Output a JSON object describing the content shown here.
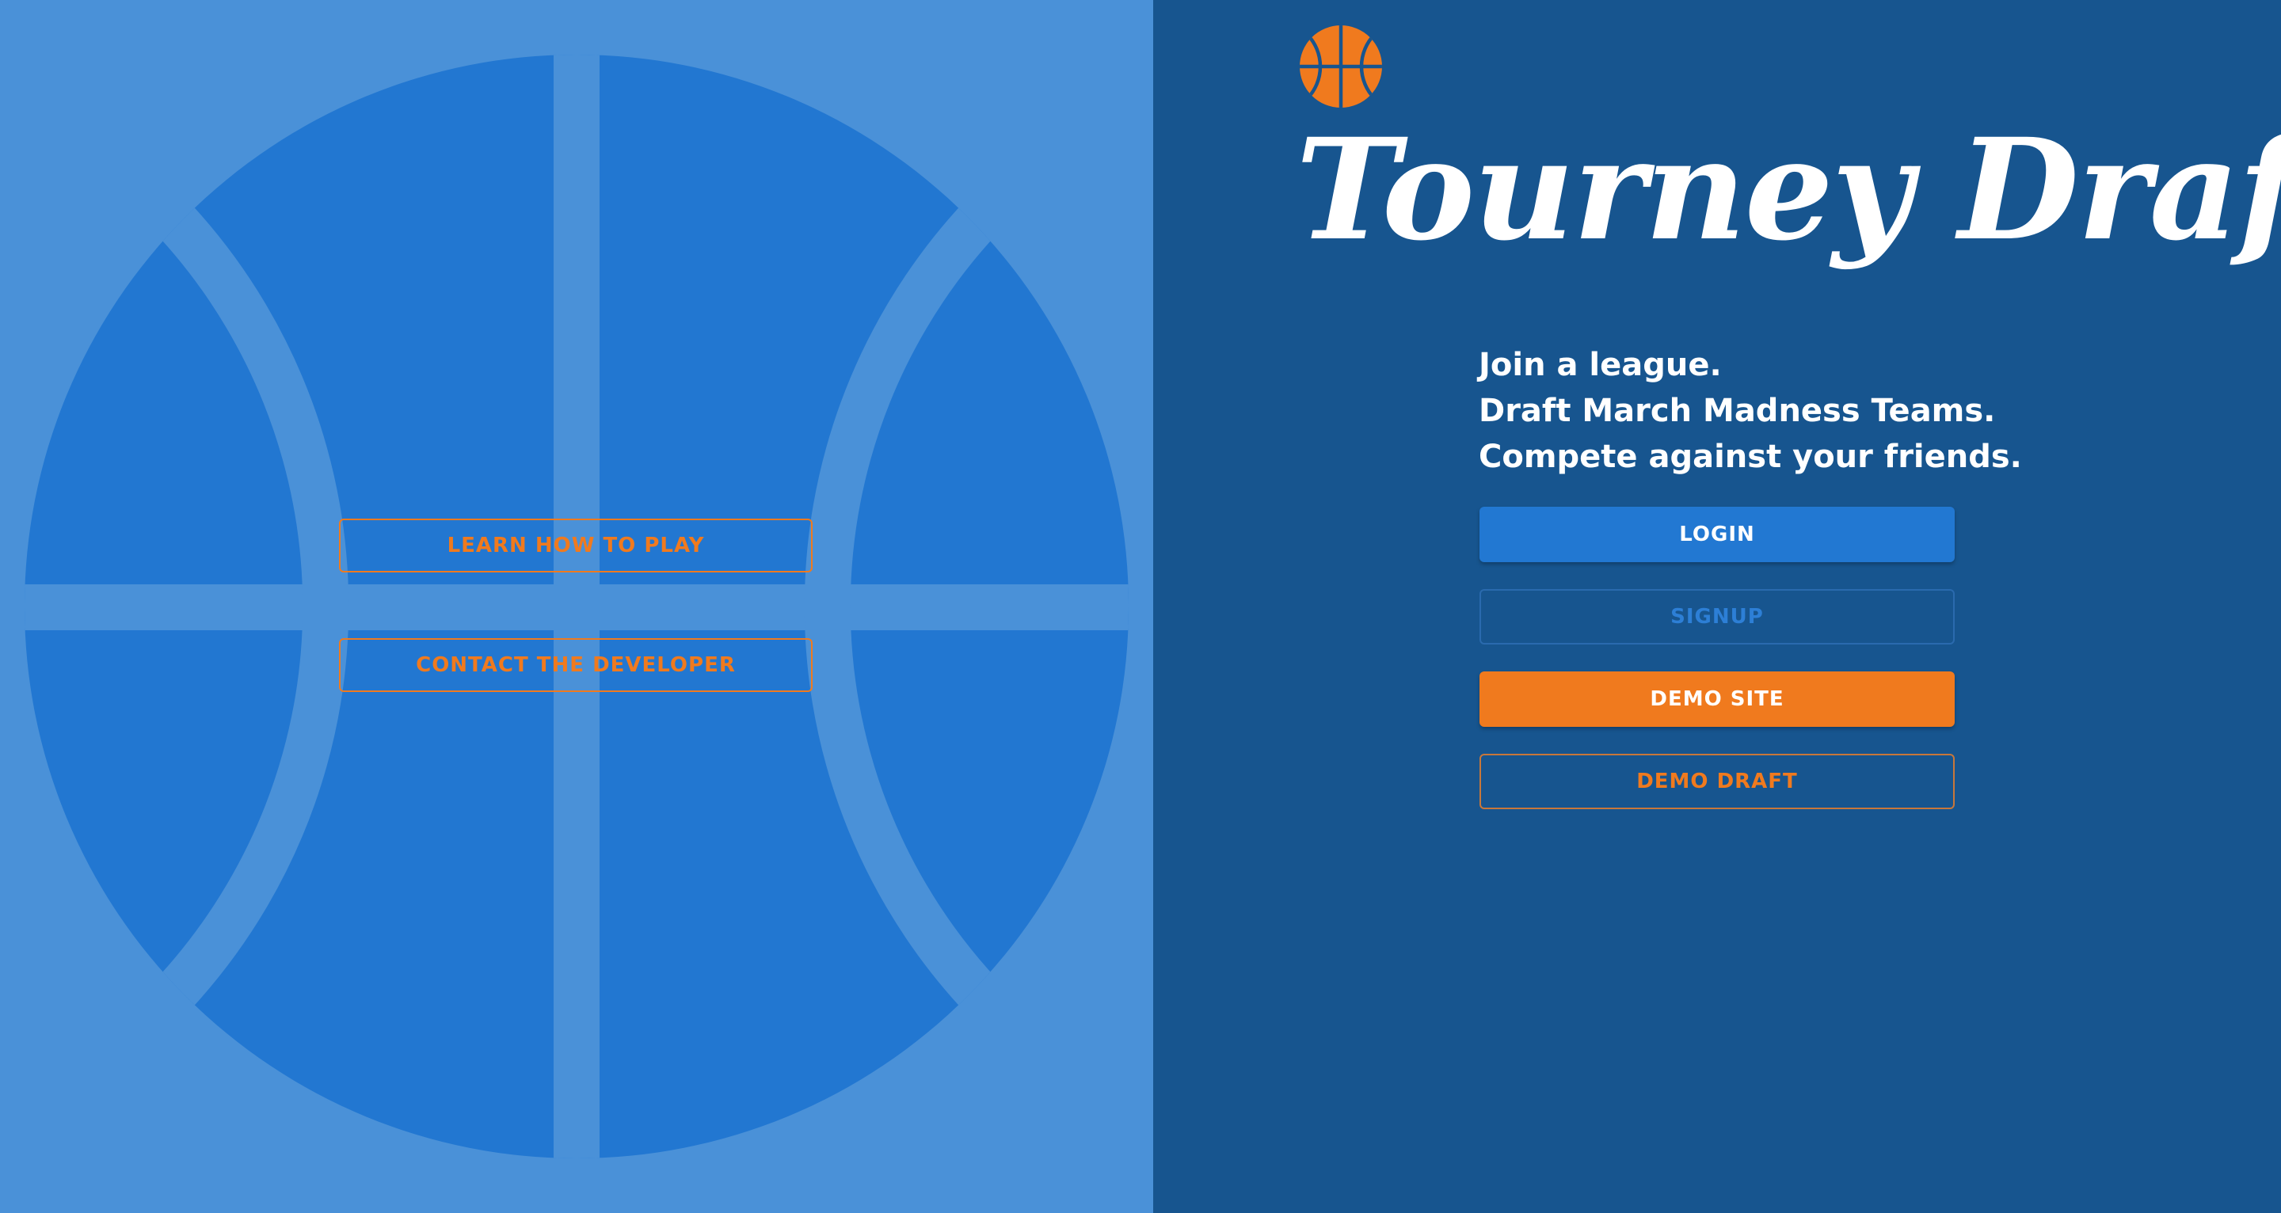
{
  "colors": {
    "left_background": "#4a91d8",
    "ball_fill": "#2277d1",
    "right_background": "#17558f",
    "accent_orange": "#f07a1e",
    "primary_blue": "#2278d2",
    "text_white": "#ffffff"
  },
  "left": {
    "background_graphic": "basketball-icon",
    "learn_button": "LEARN HOW TO PLAY",
    "contact_button": "CONTACT THE DEVELOPER"
  },
  "header": {
    "logo_icon": "basketball-icon",
    "title": "Tourney Draft"
  },
  "tagline": {
    "line1": "Join a league.",
    "line2": "Draft March Madness Teams.",
    "line3": "Compete against your friends."
  },
  "actions": {
    "login": "LOGIN",
    "signup": "SIGNUP",
    "demo_site": "DEMO SITE",
    "demo_draft": "DEMO DRAFT"
  }
}
